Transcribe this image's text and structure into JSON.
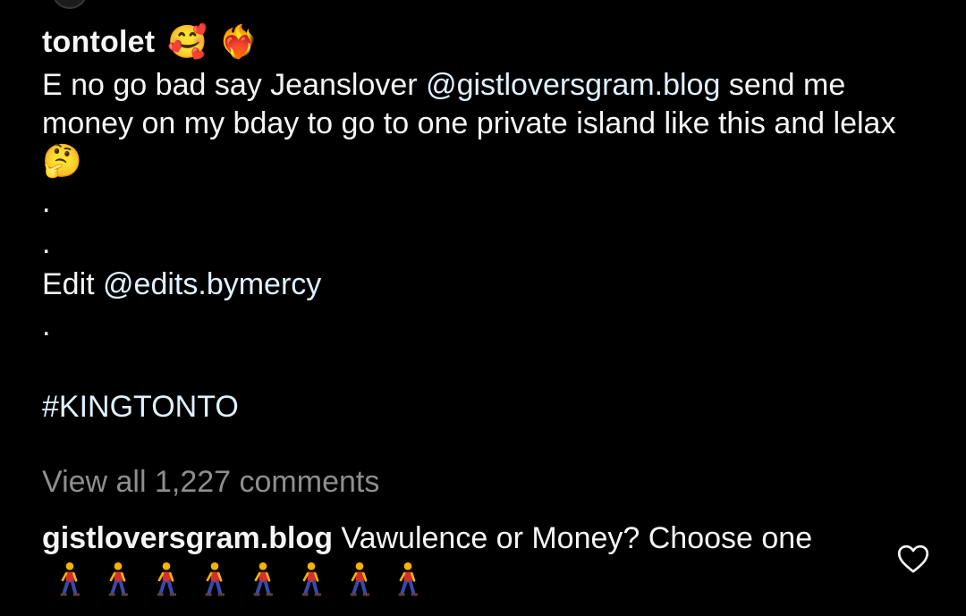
{
  "post": {
    "username": "tontolet",
    "username_emojis": [
      "🥰",
      "❤️‍🔥"
    ],
    "caption": {
      "part1": "E no go bad say Jeanslover ",
      "mention1": "@gistloversgram.blog",
      "part2": " send me money on my bday to go to one private island like this and lelax",
      "emoji": "🤔",
      "dot1": ".",
      "dot2": ".",
      "edit_prefix": "Edit ",
      "edit_mention": "@edits.bymercy",
      "dot3": ".",
      "hashtag": "#KINGTONTO"
    },
    "view_all_comments": "View all 1,227 comments"
  },
  "comment": {
    "username": "gistloversgram.blog",
    "text": " Vawulence or Money? Choose one",
    "walker_emoji_count": 8,
    "like_icon": "heart-outline-icon"
  },
  "colors": {
    "background": "#000000",
    "text": "#f5f5f5",
    "muted": "#8e8e8e",
    "link": "#e0f1ff"
  }
}
